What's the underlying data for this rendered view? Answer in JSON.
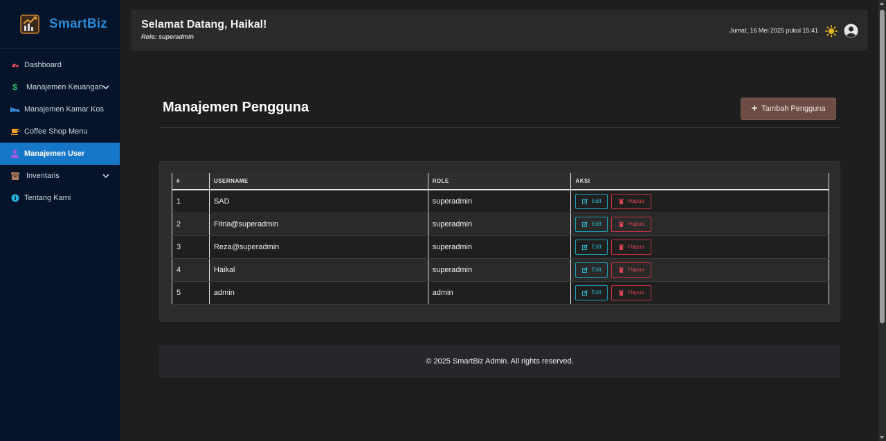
{
  "brand": {
    "name": "SmartBiz"
  },
  "sidebar": {
    "items": [
      {
        "label": "Dashboard",
        "icon": "gauge-icon",
        "color": "#e04a5a"
      },
      {
        "label": "Manajemen Keuangan",
        "icon": "dollar-icon",
        "color": "#36c26b",
        "expandable": true
      },
      {
        "label": "Manajemen Kamar Kos",
        "icon": "bed-icon",
        "color": "#3a8ee0"
      },
      {
        "label": "Coffee Shop Menu",
        "icon": "coffee-icon",
        "color": "#f0a020"
      },
      {
        "label": "Manajemen User",
        "icon": "user-icon",
        "color": "#a45be0",
        "active": true
      },
      {
        "label": "Inventaris",
        "icon": "box-icon",
        "color": "#b07a5a",
        "expandable": true
      },
      {
        "label": "Tentang Kami",
        "icon": "info-icon",
        "color": "#28b4d8"
      }
    ]
  },
  "header": {
    "greeting": "Selamat Datang, Haikal!",
    "role": "Role: superadmin",
    "datetime": "Jumat, 16 Mei 2025 pukul 15:41",
    "theme_icon": "sun-icon",
    "profile_icon": "user-circle-icon"
  },
  "main": {
    "title": "Manajemen Pengguna",
    "add_button": "Tambah Pengguna"
  },
  "table": {
    "headers": [
      "#",
      "USERNAME",
      "ROLE",
      "AKSI"
    ],
    "rows": [
      {
        "no": "1",
        "username": "SAD",
        "role": "superadmin"
      },
      {
        "no": "2",
        "username": "Fitria@superadmin",
        "role": "superadmin"
      },
      {
        "no": "3",
        "username": "Reza@superadmin",
        "role": "superadmin"
      },
      {
        "no": "4",
        "username": "Haikal",
        "role": "superadmin"
      },
      {
        "no": "5",
        "username": "admin",
        "role": "admin"
      }
    ],
    "edit_label": "Edit",
    "delete_label": "Hapus"
  },
  "footer": {
    "text": "© 2025 SmartBiz Admin. All rights reserved."
  },
  "colors": {
    "accent": "#1676c8",
    "add_button": "#6d4c44",
    "edit": "#1aa1b8",
    "delete": "#c8323f"
  }
}
